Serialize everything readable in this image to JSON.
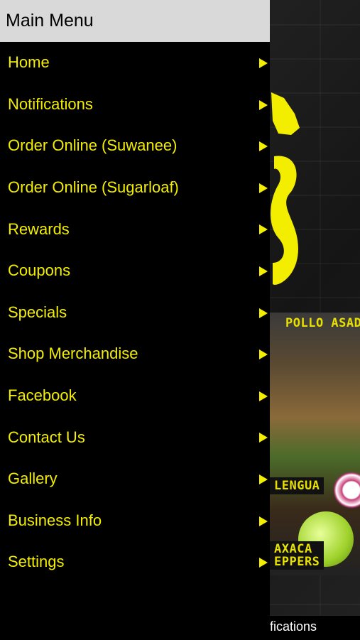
{
  "menu": {
    "title": "Main Menu",
    "items": [
      {
        "label": "Home"
      },
      {
        "label": "Notifications"
      },
      {
        "label": "Order Online (Suwanee)"
      },
      {
        "label": "Order Online (Sugarloaf)"
      },
      {
        "label": "Rewards"
      },
      {
        "label": "Coupons"
      },
      {
        "label": "Specials"
      },
      {
        "label": "Shop Merchandise"
      },
      {
        "label": "Facebook"
      },
      {
        "label": "Contact Us"
      },
      {
        "label": "Gallery"
      },
      {
        "label": "Business Info"
      },
      {
        "label": "Settings"
      }
    ],
    "arrow_icon": "triangle-right-icon"
  },
  "background": {
    "labels": {
      "pollo": "POLLO ASADO",
      "lengua": "LENGUA",
      "oaxaca_line1": "AXACA",
      "oaxaca_line2": "EPPERS"
    },
    "tab_label": "fications"
  },
  "colors": {
    "menu_text": "#f3ee00",
    "menu_bg": "#000000",
    "header_bg": "#d9d9d9"
  }
}
